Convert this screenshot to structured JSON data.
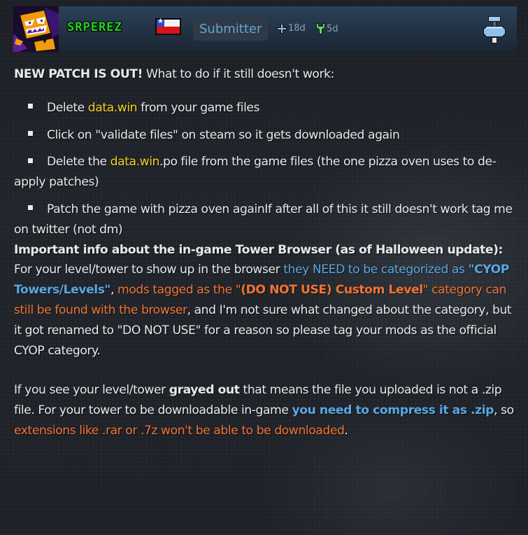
{
  "header": {
    "avatar_alt": "sRPEREZ avatar",
    "username": "sRPEREZ",
    "country_flag": "Chile",
    "role_badge": "Submitter",
    "stats": {
      "added_icon": "plus-icon",
      "added": "18d",
      "updated_icon": "wrench-icon",
      "updated": "5d"
    },
    "pin_icon": "pin-icon"
  },
  "colors": {
    "username": "#25d225",
    "badge_text": "#67a3d3",
    "highlight_yellow": "#f5cd1f",
    "highlight_blue": "#5aa7e0",
    "highlight_orange": "#f07434"
  },
  "post": {
    "intro_bold": "NEW PATCH IS OUT!",
    "intro_rest": " What to do if it still doesn't work:",
    "steps": [
      {
        "pre": "Delete ",
        "highlight": "data.win",
        "post": " from your game files"
      },
      {
        "text": "Click on \"validate files\" on steam so it gets downloaded again"
      },
      {
        "pre": "Delete the ",
        "highlight": "data.win",
        "post": ".po file from the game files (the one pizza oven uses to de-apply patches)"
      },
      {
        "text": "Patch the game with pizza oven againIf after all of this it still doesn't work tag me on twitter (not dm)"
      }
    ],
    "browser_heading": "Important info about the in-game Tower Browser (as of Halloween update):",
    "browser_p1": {
      "t1": "For your level/tower to show up in the browser ",
      "blue1": "they NEED to be categorized as ",
      "blue_bold": "\"CYOP Towers/Levels\"",
      "t2": ", ",
      "orange1": "mods tagged as the \"",
      "orange_bold": "(DO NOT USE) Custom Level",
      "orange2": "\" category can still be found with the browser",
      "t3": ", and I'm not sure what changed about the category, but it got renamed to \"DO NOT USE\" for a reason so please tag your mods as the official CYOP category."
    },
    "browser_p2": {
      "t1": "If you see your level/tower ",
      "bold1": "grayed out",
      "t2": " that means the file you uploaded is not a .zip file. For your tower to be downloadable in-game ",
      "blue_bold": "you need to compress it as .zip",
      "t3": ", so ",
      "orange": "extensions like .rar or .7z won't be able to be downloaded",
      "t4": "."
    }
  }
}
